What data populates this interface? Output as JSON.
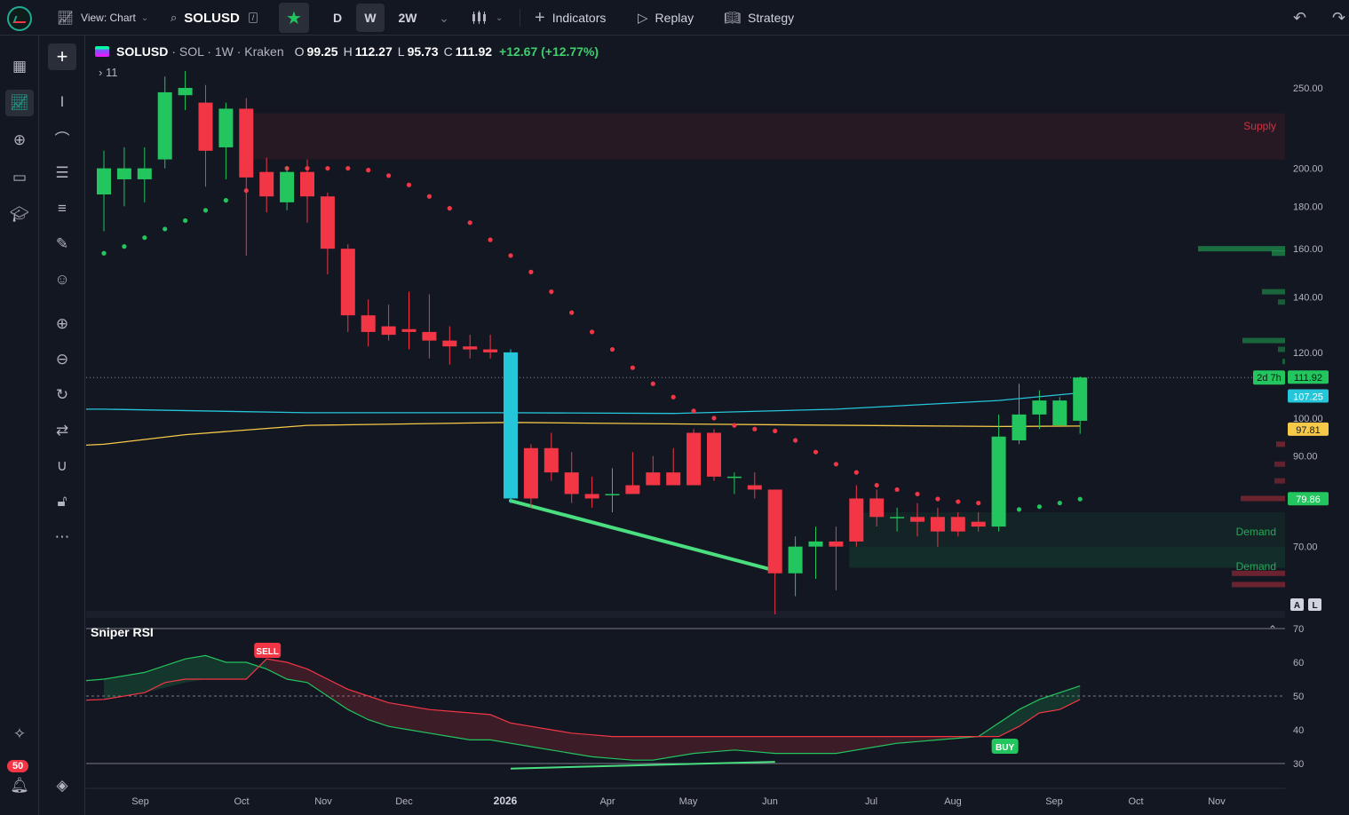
{
  "toolbar": {
    "view_label": "View: Chart",
    "symbol": "SOLUSD",
    "timeframes": [
      "D",
      "W",
      "2W"
    ],
    "active_timeframe": "W",
    "indicators_label": "Indicators",
    "replay_label": "Replay",
    "strategy_label": "Strategy"
  },
  "legend": {
    "symbol": "SOLUSD",
    "meta": "· SOL · 1W · Kraken",
    "open_label": "O",
    "open": "99.25",
    "high_label": "H",
    "high": "112.27",
    "low_label": "L",
    "low": "95.73",
    "close_label": "C",
    "close": "111.92",
    "change": "+12.67 (+12.77%)",
    "collapsed_count": "11"
  },
  "sidebar": {
    "notification_count": "50"
  },
  "colors": {
    "up": "#22c55e",
    "down": "#f23645",
    "ema_fast": "#26c6da",
    "ema_slow": "#f7c948",
    "highlight_candle": "#26c6da",
    "trend_line": "#4ade80",
    "background": "#131722"
  },
  "price_axis": {
    "labels": [
      "250.00",
      "200.00",
      "180.00",
      "160.00",
      "140.00",
      "120.00",
      "100.00",
      "90.00",
      "70.00"
    ],
    "countdown": "2d 7h",
    "last_price": "111.92",
    "ema_fast_value": "107.25",
    "ema_slow_value": "97.81",
    "sar_value": "79.86",
    "scale_buttons": [
      "A",
      "L"
    ]
  },
  "zones": {
    "supply_label": "Supply",
    "demand_label_1": "Demand",
    "demand_label_2": "Demand"
  },
  "rsi": {
    "title": "Sniper RSI",
    "levels": [
      "70",
      "60",
      "50",
      "40",
      "30"
    ],
    "sell_label": "SELL",
    "buy_label": "BUY"
  },
  "time_axis": [
    "Sep",
    "Oct",
    "Nov",
    "Dec",
    "2026",
    "Apr",
    "May",
    "Jun",
    "Jul",
    "Aug",
    "Sep",
    "Oct",
    "Nov"
  ],
  "chart_data": {
    "type": "candlestick",
    "ylim": [
      58,
      262
    ],
    "y_scale": "log",
    "candles": [
      {
        "o": 186,
        "h": 210,
        "l": 168,
        "c": 200
      },
      {
        "o": 194,
        "h": 212,
        "l": 180,
        "c": 200
      },
      {
        "o": 194,
        "h": 212,
        "l": 182,
        "c": 200
      },
      {
        "o": 205,
        "h": 258,
        "l": 200,
        "c": 247
      },
      {
        "o": 245,
        "h": 262,
        "l": 235,
        "c": 250
      },
      {
        "o": 240,
        "h": 252,
        "l": 190,
        "c": 210
      },
      {
        "o": 212,
        "h": 240,
        "l": 194,
        "c": 236
      },
      {
        "o": 236,
        "h": 243,
        "l": 157,
        "c": 195
      },
      {
        "o": 198,
        "h": 206,
        "l": 177,
        "c": 185
      },
      {
        "o": 182,
        "h": 201,
        "l": 178,
        "c": 198
      },
      {
        "o": 198,
        "h": 205,
        "l": 172,
        "c": 185
      },
      {
        "o": 185,
        "h": 187,
        "l": 149,
        "c": 160
      },
      {
        "o": 160,
        "h": 162,
        "l": 127,
        "c": 133
      },
      {
        "o": 133,
        "h": 139,
        "l": 122,
        "c": 127
      },
      {
        "o": 129,
        "h": 137,
        "l": 124,
        "c": 126
      },
      {
        "o": 128,
        "h": 142,
        "l": 121,
        "c": 127
      },
      {
        "o": 127,
        "h": 141,
        "l": 118,
        "c": 124
      },
      {
        "o": 124,
        "h": 129,
        "l": 116,
        "c": 122
      },
      {
        "o": 122,
        "h": 126,
        "l": 118,
        "c": 121
      },
      {
        "o": 121,
        "h": 126,
        "l": 118,
        "c": 120
      },
      {
        "o": 80,
        "h": 121,
        "l": 79,
        "c": 120
      },
      {
        "o": 92,
        "h": 93,
        "l": 78,
        "c": 80
      },
      {
        "o": 92,
        "h": 96,
        "l": 84,
        "c": 86
      },
      {
        "o": 86,
        "h": 91,
        "l": 79,
        "c": 81
      },
      {
        "o": 81,
        "h": 85,
        "l": 78,
        "c": 80
      },
      {
        "o": 81,
        "h": 87,
        "l": 77,
        "c": 81
      },
      {
        "o": 83,
        "h": 91,
        "l": 81,
        "c": 81
      },
      {
        "o": 86,
        "h": 90,
        "l": 83,
        "c": 83
      },
      {
        "o": 86,
        "h": 92,
        "l": 83,
        "c": 83
      },
      {
        "o": 96,
        "h": 97,
        "l": 83,
        "c": 83
      },
      {
        "o": 96,
        "h": 97,
        "l": 84,
        "c": 85
      },
      {
        "o": 85,
        "h": 86,
        "l": 81,
        "c": 85
      },
      {
        "o": 83,
        "h": 86,
        "l": 80,
        "c": 82
      },
      {
        "o": 82,
        "h": 82,
        "l": 58,
        "c": 65
      },
      {
        "o": 65,
        "h": 72,
        "l": 61,
        "c": 70
      },
      {
        "o": 70,
        "h": 74,
        "l": 64,
        "c": 71
      },
      {
        "o": 71,
        "h": 74,
        "l": 62,
        "c": 70
      },
      {
        "o": 80,
        "h": 83,
        "l": 70,
        "c": 71
      },
      {
        "o": 80,
        "h": 82,
        "l": 74,
        "c": 76
      },
      {
        "o": 76,
        "h": 78,
        "l": 73,
        "c": 76
      },
      {
        "o": 76,
        "h": 79,
        "l": 72,
        "c": 75
      },
      {
        "o": 76,
        "h": 78,
        "l": 70,
        "c": 73
      },
      {
        "o": 76,
        "h": 77,
        "l": 72,
        "c": 73
      },
      {
        "o": 75,
        "h": 77,
        "l": 73,
        "c": 74
      },
      {
        "o": 74,
        "h": 101,
        "l": 73,
        "c": 95
      },
      {
        "o": 94,
        "h": 110,
        "l": 93,
        "c": 101
      },
      {
        "o": 101,
        "h": 108,
        "l": 97,
        "c": 105
      },
      {
        "o": 98,
        "h": 106,
        "l": 98,
        "c": 105
      },
      {
        "o": 99.25,
        "h": 112.27,
        "l": 95.73,
        "c": 111.92
      }
    ],
    "highlight_candle_index": 20,
    "ema_fast": [
      [
        0,
        102.5
      ],
      [
        10,
        101.5
      ],
      [
        20,
        101.5
      ],
      [
        28,
        101.3
      ],
      [
        36,
        102.5
      ],
      [
        44,
        105.0
      ],
      [
        48,
        107.25
      ]
    ],
    "ema_slow": [
      [
        0,
        93
      ],
      [
        4,
        95.5
      ],
      [
        10,
        98
      ],
      [
        20,
        98.8
      ],
      [
        30,
        98.3
      ],
      [
        44,
        97.7
      ],
      [
        48,
        97.81
      ]
    ],
    "sar": [
      [
        0,
        158
      ],
      [
        1,
        161
      ],
      [
        2,
        165
      ],
      [
        3,
        169
      ],
      [
        4,
        173
      ],
      [
        5,
        178
      ],
      [
        6,
        183
      ],
      [
        7,
        188
      ],
      [
        8,
        196
      ],
      [
        9,
        200
      ],
      [
        10,
        200
      ],
      [
        11,
        200
      ],
      [
        12,
        200
      ],
      [
        13,
        199
      ],
      [
        14,
        196
      ],
      [
        15,
        191
      ],
      [
        16,
        185
      ],
      [
        17,
        179
      ],
      [
        18,
        172
      ],
      [
        19,
        164
      ],
      [
        20,
        157
      ],
      [
        21,
        150
      ],
      [
        22,
        142
      ],
      [
        23,
        134
      ],
      [
        24,
        127
      ],
      [
        25,
        121
      ],
      [
        26,
        115
      ],
      [
        27,
        110
      ],
      [
        28,
        106
      ],
      [
        29,
        102
      ],
      [
        30,
        100
      ],
      [
        31,
        98
      ],
      [
        32,
        97
      ],
      [
        33,
        96.5
      ],
      [
        34,
        94
      ],
      [
        35,
        91
      ],
      [
        36,
        88
      ],
      [
        37,
        86
      ],
      [
        38,
        83
      ],
      [
        39,
        82
      ],
      [
        40,
        81
      ],
      [
        41,
        79.9
      ],
      [
        42,
        79.3
      ],
      [
        43,
        79
      ],
      [
        44,
        77
      ],
      [
        45,
        77.6
      ],
      [
        46,
        78.2
      ],
      [
        47,
        79
      ],
      [
        48,
        79.86
      ]
    ],
    "trend_line": [
      [
        20,
        79.5
      ],
      [
        33,
        65.5
      ]
    ],
    "zones": [
      {
        "label": "Supply",
        "from_index": 7,
        "y_low": 205,
        "y_high": 233
      },
      {
        "label": "Demand",
        "from_index": 37,
        "y_low": 66,
        "y_high": 77
      },
      {
        "label": "Demand",
        "from_index": 37,
        "y_low": 66,
        "y_high": 70
      }
    ],
    "rsi_levels": [
      70,
      60,
      50,
      40,
      30
    ],
    "rsi_fast": [
      [
        0,
        55
      ],
      [
        2,
        57
      ],
      [
        4,
        61
      ],
      [
        5,
        62
      ],
      [
        6,
        60
      ],
      [
        7,
        60
      ],
      [
        8,
        58
      ],
      [
        9,
        55
      ],
      [
        10,
        54
      ],
      [
        11,
        50
      ],
      [
        12,
        46
      ],
      [
        13,
        43
      ],
      [
        14,
        41
      ],
      [
        15,
        40
      ],
      [
        16,
        39
      ],
      [
        17,
        38
      ],
      [
        18,
        37
      ],
      [
        19,
        37
      ],
      [
        20,
        36
      ],
      [
        21,
        35
      ],
      [
        22,
        34
      ],
      [
        23,
        33
      ],
      [
        24,
        32
      ],
      [
        25,
        31.5
      ],
      [
        26,
        31
      ],
      [
        27,
        31
      ],
      [
        28,
        32
      ],
      [
        29,
        33
      ],
      [
        30,
        33.5
      ],
      [
        31,
        34
      ],
      [
        32,
        33.5
      ],
      [
        33,
        33
      ],
      [
        34,
        33
      ],
      [
        35,
        33
      ],
      [
        36,
        33
      ],
      [
        37,
        34
      ],
      [
        38,
        35
      ],
      [
        39,
        36
      ],
      [
        40,
        36.5
      ],
      [
        41,
        37
      ],
      [
        42,
        37.5
      ],
      [
        43,
        38
      ],
      [
        44,
        42
      ],
      [
        45,
        46
      ],
      [
        46,
        49
      ],
      [
        47,
        51
      ],
      [
        48,
        53
      ]
    ],
    "rsi_slow": [
      [
        0,
        49
      ],
      [
        2,
        51
      ],
      [
        3,
        54
      ],
      [
        4,
        55
      ],
      [
        6,
        55
      ],
      [
        7,
        55
      ],
      [
        8,
        61
      ],
      [
        9,
        60
      ],
      [
        10,
        58
      ],
      [
        11,
        55
      ],
      [
        12,
        52
      ],
      [
        13,
        50
      ],
      [
        14,
        48
      ],
      [
        15,
        47
      ],
      [
        16,
        46
      ],
      [
        17,
        45.5
      ],
      [
        18,
        45
      ],
      [
        19,
        44.5
      ],
      [
        20,
        42
      ],
      [
        21,
        41
      ],
      [
        22,
        40
      ],
      [
        23,
        39
      ],
      [
        24,
        38.5
      ],
      [
        25,
        38
      ],
      [
        26,
        38
      ],
      [
        27,
        38
      ],
      [
        28,
        38
      ],
      [
        29,
        38
      ],
      [
        30,
        38
      ],
      [
        31,
        38
      ],
      [
        32,
        38
      ],
      [
        33,
        38
      ],
      [
        34,
        38
      ],
      [
        35,
        38
      ],
      [
        36,
        38
      ],
      [
        37,
        38
      ],
      [
        38,
        38
      ],
      [
        39,
        38
      ],
      [
        40,
        38
      ],
      [
        41,
        38
      ],
      [
        42,
        38
      ],
      [
        43,
        38
      ],
      [
        44,
        38
      ],
      [
        45,
        41
      ],
      [
        46,
        45
      ],
      [
        47,
        46
      ],
      [
        48,
        49
      ]
    ],
    "rsi_divergence": [
      [
        20,
        28.5
      ],
      [
        33,
        30.5
      ]
    ],
    "sell_signal_index": 8,
    "buy_signal_index": 44
  }
}
